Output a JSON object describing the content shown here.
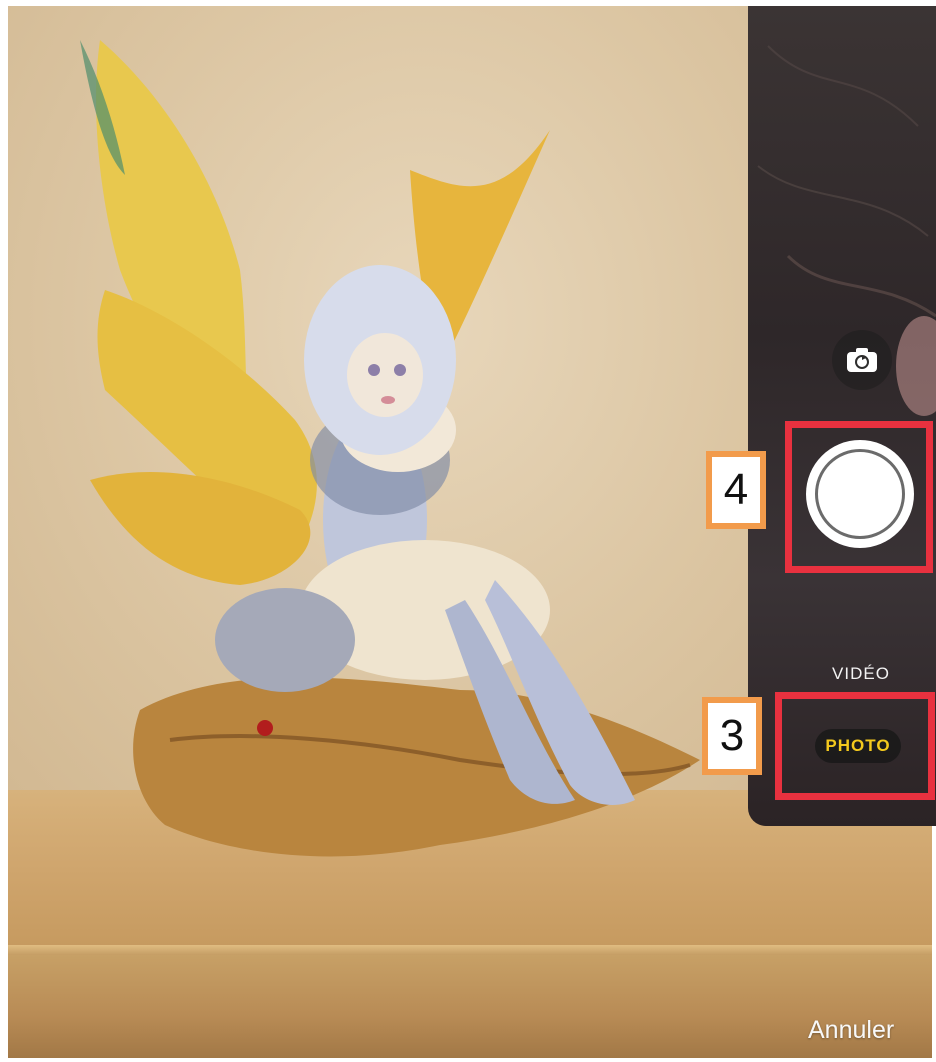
{
  "camera": {
    "modes": {
      "video_label": "VIDÉO",
      "photo_label": "PHOTO"
    },
    "active_mode": "PHOTO",
    "switch_camera_icon": "camera-rotate-icon",
    "cancel_label": "Annuler",
    "accent_color": "#f4c91d"
  },
  "annotations": [
    {
      "label": "4",
      "color": "#e8313f",
      "badge_color": "#f29b4b"
    },
    {
      "label": "3",
      "color": "#e8313f",
      "badge_color": "#f29b4b"
    }
  ]
}
